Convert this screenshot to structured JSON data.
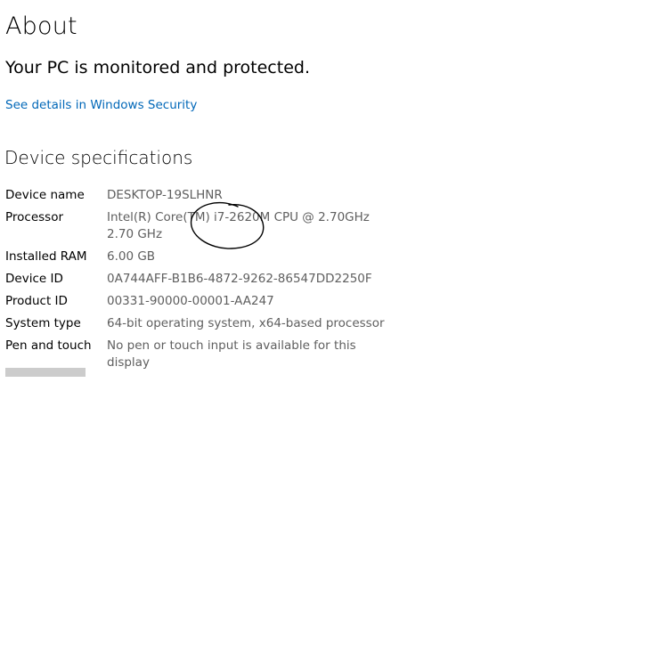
{
  "page": {
    "title": "About",
    "protection_status": "Your PC is monitored and protected.",
    "security_link": "See details in Windows Security"
  },
  "specs": {
    "heading": "Device specifications",
    "rows": [
      {
        "label": "Device name",
        "value": "DESKTOP-19SLHNR"
      },
      {
        "label": "Processor",
        "value": "Intel(R) Core(TM) i7-2620M CPU @ 2.70GHz   2.70 GHz"
      },
      {
        "label": "Installed RAM",
        "value": "6.00 GB"
      },
      {
        "label": "Device ID",
        "value": "0A744AFF-B1B6-4872-9262-86547DD2250F"
      },
      {
        "label": "Product ID",
        "value": "00331-90000-00001-AA247"
      },
      {
        "label": "System type",
        "value": "64-bit operating system, x64-based processor"
      },
      {
        "label": "Pen and touch",
        "value": "No pen or touch input is available for this display"
      }
    ]
  },
  "colors": {
    "link": "#0067b8",
    "value_text": "#5f5f5f",
    "button_placeholder": "#cccccc"
  }
}
